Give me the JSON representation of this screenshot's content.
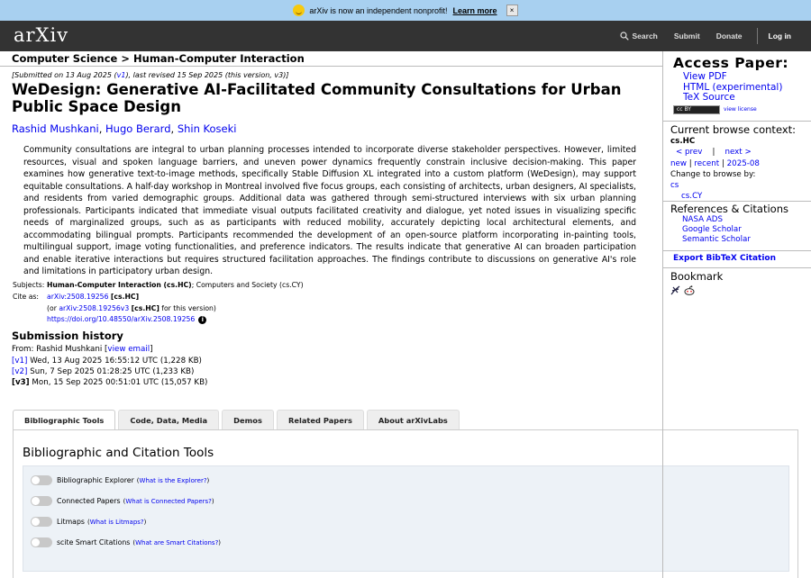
{
  "banner": {
    "text": "arXiv is now an independent nonprofit!",
    "link": "Learn more",
    "close": "×"
  },
  "header": {
    "logo": "arXiv",
    "search": "Search",
    "submit": "Submit",
    "donate": "Donate",
    "login": "Log in"
  },
  "breadcrumb": "Computer Science > Human-Computer Interaction",
  "submitted": {
    "prefix": "[Submitted on 13 Aug 2025 (",
    "v1": "v1",
    "suffix": "), last revised 15 Sep 2025 (this version, v3)]"
  },
  "title": "WeDesign: Generative AI-Facilitated Community Consultations for Urban Public Space Design",
  "authors": [
    "Rashid Mushkani",
    "Hugo Berard",
    "Shin Koseki"
  ],
  "abstract": "Community consultations are integral to urban planning processes intended to incorporate diverse stakeholder perspectives. However, limited resources, visual and spoken language barriers, and uneven power dynamics frequently constrain inclusive decision-making. This paper examines how generative text-to-image methods, specifically Stable Diffusion XL integrated into a custom platform (WeDesign), may support equitable consultations. A half-day workshop in Montreal involved five focus groups, each consisting of architects, urban designers, AI specialists, and residents from varied demographic groups. Additional data was gathered through semi-structured interviews with six urban planning professionals. Participants indicated that immediate visual outputs facilitated creativity and dialogue, yet noted issues in visualizing specific needs of marginalized groups, such as as participants with reduced mobility, accurately depicting local architectural elements, and accommodating bilingual prompts. Participants recommended the development of an open-source platform incorporating in-painting tools, multilingual support, image voting functionalities, and preference indicators. The results indicate that generative AI can broaden participation and enable iterative interactions but requires structured facilitation approaches. The findings contribute to discussions on generative AI's role and limitations in participatory urban design.",
  "meta": {
    "subjects_label": "Subjects:",
    "subjects_primary": "Human-Computer Interaction (cs.HC)",
    "subjects_rest": "; Computers and Society (cs.CY)",
    "cite_label": "Cite as:",
    "cite_id": "arXiv:2508.19256",
    "cite_cat": "[cs.HC]",
    "cite_or_prefix": "(or ",
    "cite_version": "arXiv:2508.19256v3",
    "cite_or_cat": "[cs.HC]",
    "cite_or_suffix": " for this version)",
    "doi": "https://doi.org/10.48550/arXiv.2508.19256",
    "info_icon": "i"
  },
  "history": {
    "heading": "Submission history",
    "from_prefix": "From: Rashid Mushkani [",
    "view_email": "view email",
    "from_suffix": "]",
    "versions": [
      {
        "tag": "[v1]",
        "text": " Wed, 13 Aug 2025 16:55:12 UTC (1,228 KB)",
        "current": false
      },
      {
        "tag": "[v2]",
        "text": " Sun, 7 Sep 2025 01:28:25 UTC (1,233 KB)",
        "current": false
      },
      {
        "tag": "[v3]",
        "text": " Mon, 15 Sep 2025 00:51:01 UTC (15,057 KB)",
        "current": true
      }
    ]
  },
  "tabs": [
    "Bibliographic Tools",
    "Code, Data, Media",
    "Demos",
    "Related Papers",
    "About arXivLabs"
  ],
  "panel": {
    "heading": "Bibliographic and Citation Tools",
    "toggles": [
      {
        "label": "Bibliographic Explorer",
        "help": "What is the Explorer?"
      },
      {
        "label": "Connected Papers",
        "help": "What is Connected Papers?"
      },
      {
        "label": "Litmaps",
        "help": "What is Litmaps?"
      },
      {
        "label": "scite Smart Citations",
        "help": "What are Smart Citations?"
      }
    ]
  },
  "sidebar": {
    "access_heading": "Access Paper:",
    "view_pdf": "View PDF",
    "html": "HTML (experimental)",
    "tex": "TeX Source",
    "license_badge": "cc  BY",
    "view_license": "view license",
    "browse_heading": "Current browse context:",
    "context": "cs.HC",
    "prev": "< prev",
    "pipe": "|",
    "next": "next >",
    "new": "new",
    "recent": "recent",
    "month": "2025-08",
    "change_browse": "Change to browse by:",
    "cs": "cs",
    "cscy": "cs.CY",
    "refs_heading": "References & Citations",
    "nasa": "NASA ADS",
    "scholar": "Google Scholar",
    "semantic": "Semantic Scholar",
    "export": "Export BibTeX Citation",
    "bookmark_heading": "Bookmark"
  }
}
